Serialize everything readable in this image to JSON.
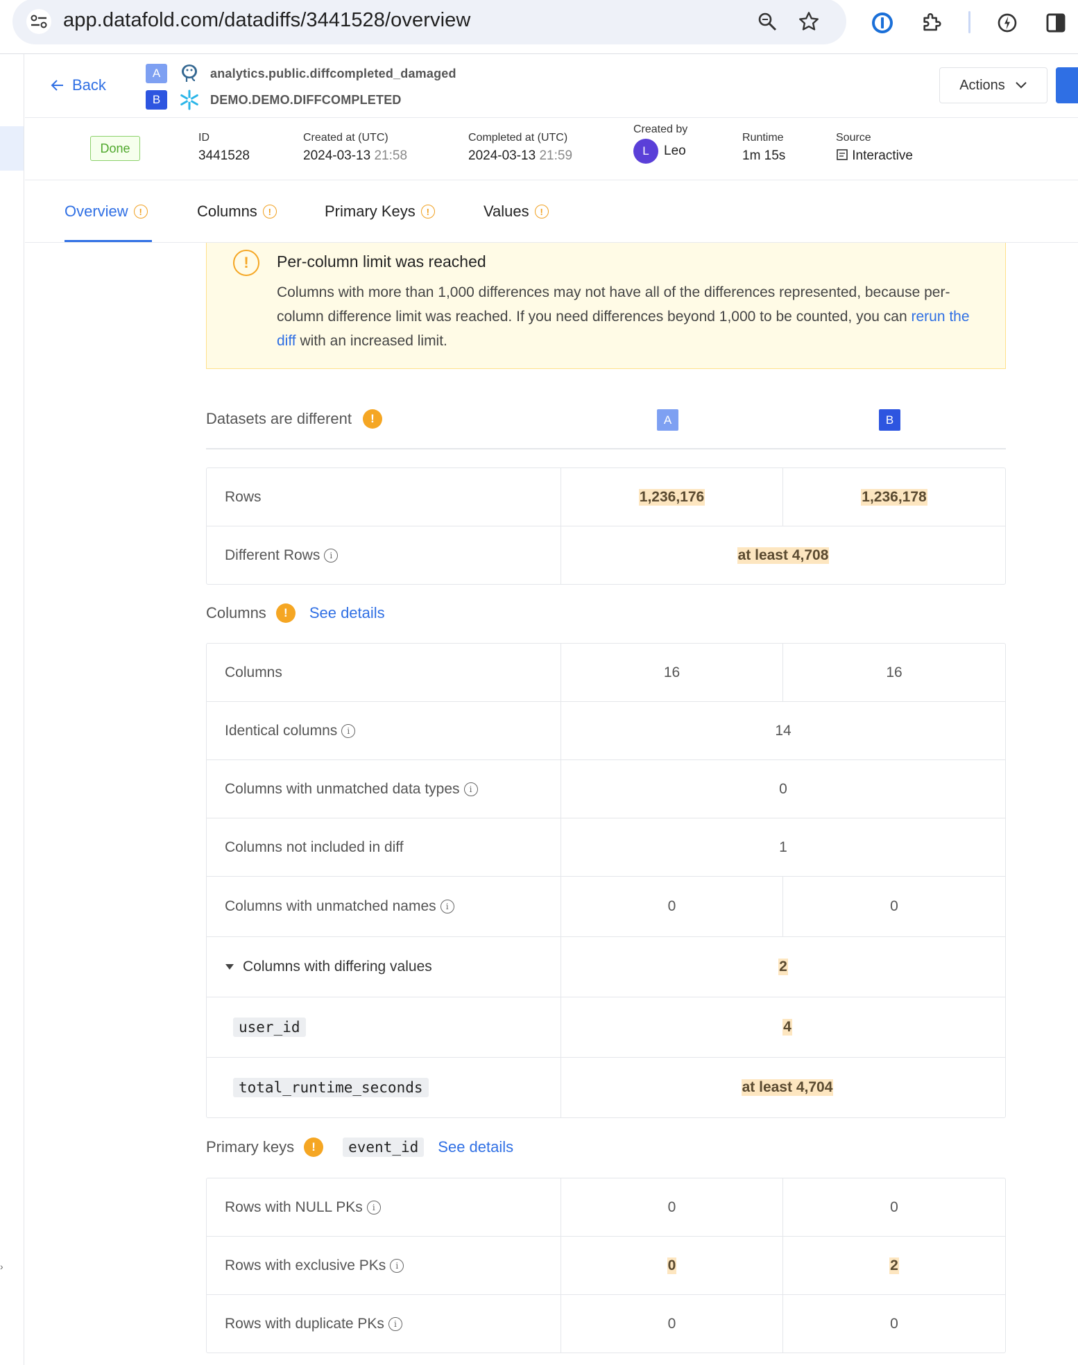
{
  "browser": {
    "url": "app.datafold.com/datadiffs/3441528/overview"
  },
  "header": {
    "back_label": "Back",
    "dataset_a_badge": "A",
    "dataset_b_badge": "B",
    "dataset_a_name": "analytics.public.diffcompleted_damaged",
    "dataset_b_name": "DEMO.DEMO.DIFFCOMPLETED",
    "actions_label": "Actions"
  },
  "meta": {
    "status": "Done",
    "id_label": "ID",
    "id_value": "3441528",
    "created_label": "Created at (UTC)",
    "created_date": "2024-03-13",
    "created_time": "21:58",
    "completed_label": "Completed at (UTC)",
    "completed_date": "2024-03-13",
    "completed_time": "21:59",
    "created_by_label": "Created by",
    "created_by_initial": "L",
    "created_by_name": "Leo",
    "runtime_label": "Runtime",
    "runtime_value": "1m 15s",
    "source_label": "Source",
    "source_value": "Interactive"
  },
  "tabs": [
    {
      "label": "Overview",
      "active": true
    },
    {
      "label": "Columns",
      "active": false
    },
    {
      "label": "Primary Keys",
      "active": false
    },
    {
      "label": "Values",
      "active": false
    }
  ],
  "alert": {
    "title": "Per-column limit was reached",
    "body_before": "Columns with more than 1,000 differences may not have all of the differences represented, because per-column difference limit was reached. If you need differences beyond 1,000 to be counted, you can ",
    "link_text": "rerun the diff",
    "body_after": " with an increased limit."
  },
  "datasets": {
    "heading": "Datasets are different",
    "col_a": "A",
    "col_b": "B",
    "rows_label": "Rows",
    "rows_a": "1,236,176",
    "rows_b": "1,236,178",
    "diff_rows_label": "Different Rows",
    "diff_rows_value": "at least 4,708"
  },
  "columns": {
    "heading": "Columns",
    "see_details": "See details",
    "columns_label": "Columns",
    "columns_a": "16",
    "columns_b": "16",
    "identical_label": "Identical columns",
    "identical_value": "14",
    "unmatched_types_label": "Columns with unmatched data types",
    "unmatched_types_value": "0",
    "not_included_label": "Columns not included in diff",
    "not_included_value": "1",
    "unmatched_names_label": "Columns with unmatched names",
    "unmatched_names_a": "0",
    "unmatched_names_b": "0",
    "differing_label": "Columns with differing values",
    "differing_value": "2",
    "differing_cols": [
      {
        "name": "user_id",
        "value": "4"
      },
      {
        "name": "total_runtime_seconds",
        "value": "at least 4,704"
      }
    ]
  },
  "primary_keys": {
    "heading": "Primary keys",
    "key_name": "event_id",
    "see_details": "See details",
    "null_label": "Rows with NULL PKs",
    "null_a": "0",
    "null_b": "0",
    "exclusive_label": "Rows with exclusive PKs",
    "exclusive_a": "0",
    "exclusive_b": "2",
    "duplicate_label": "Rows with duplicate PKs",
    "duplicate_a": "0",
    "duplicate_b": "0"
  },
  "colors": {
    "accent": "#2f6fe4",
    "badge_a": "#7ea0f2",
    "badge_b": "#2d55e0",
    "warning": "#f5a623",
    "highlight": "#fde6c0"
  }
}
